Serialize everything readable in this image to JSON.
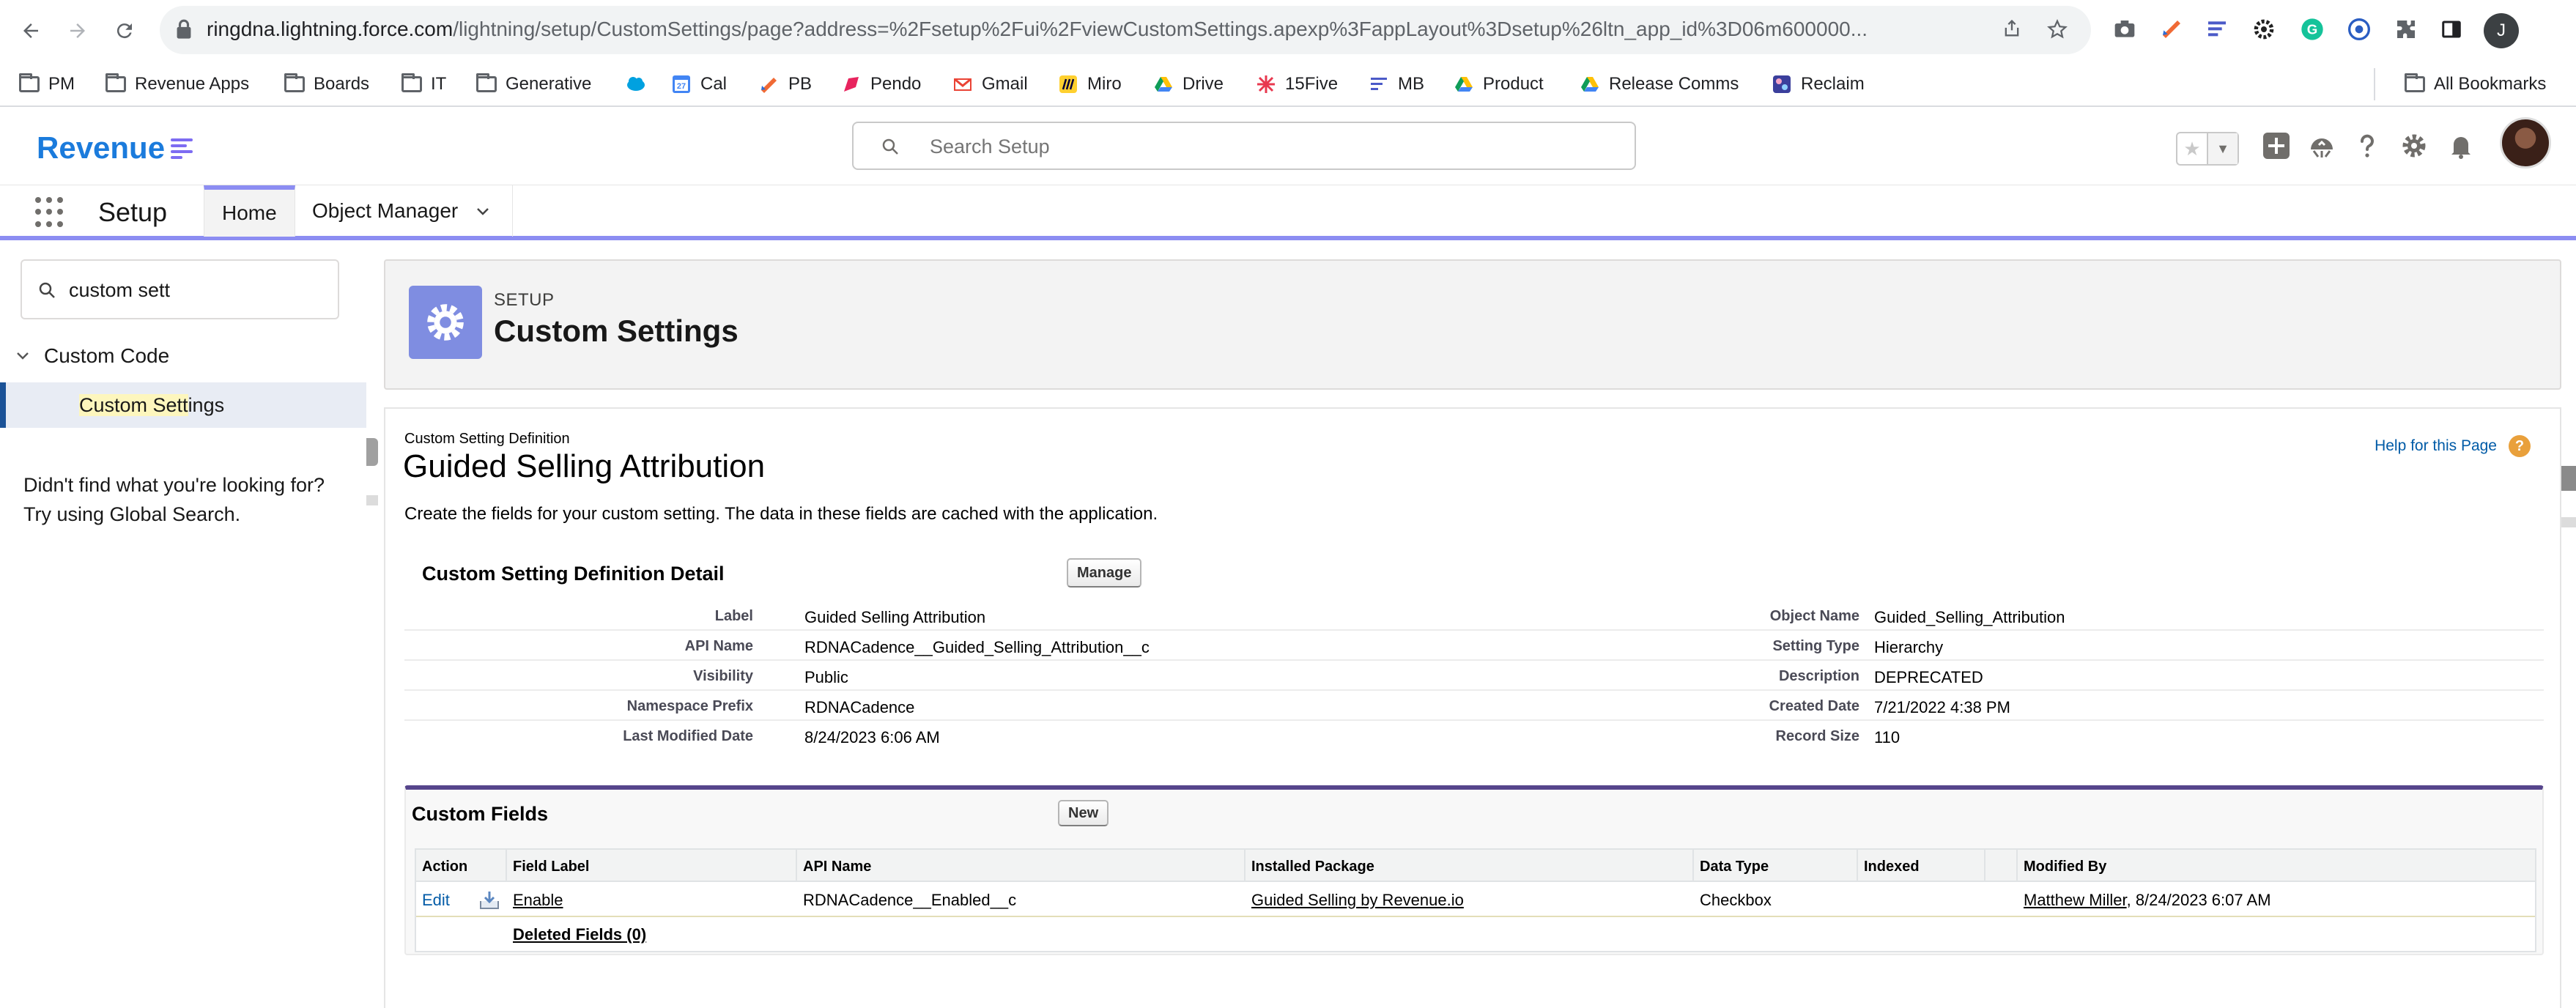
{
  "browser": {
    "url_host": "ringdna.lightning.force.com",
    "url_path": "/lightning/setup/CustomSettings/page?address=%2Fsetup%2Fui%2FviewCustomSettings.apexp%3FappLayout%3Dsetup%26ltn_app_id%3D06m600000...",
    "profile_initial": "J",
    "bookmarks": [
      {
        "label": "PM",
        "icon": "folder-icon"
      },
      {
        "label": "Revenue Apps",
        "icon": "folder-icon"
      },
      {
        "label": "Boards",
        "icon": "folder-icon"
      },
      {
        "label": "IT",
        "icon": "folder-icon"
      },
      {
        "label": "Generative",
        "icon": "folder-icon"
      },
      {
        "label": "",
        "icon": "salesforce-icon"
      },
      {
        "label": "Cal",
        "icon": "calendar-icon"
      },
      {
        "label": "PB",
        "icon": "pb-icon"
      },
      {
        "label": "Pendo",
        "icon": "pendo-icon"
      },
      {
        "label": "Gmail",
        "icon": "gmail-icon"
      },
      {
        "label": "Miro",
        "icon": "miro-icon"
      },
      {
        "label": "Drive",
        "icon": "drive-icon"
      },
      {
        "label": "15Five",
        "icon": "15five-icon"
      },
      {
        "label": "MB",
        "icon": "mb-icon"
      },
      {
        "label": "Product",
        "icon": "drive-icon"
      },
      {
        "label": "Release Comms",
        "icon": "drive-icon"
      },
      {
        "label": "Reclaim",
        "icon": "reclaim-icon"
      }
    ],
    "all_bookmarks": "All Bookmarks"
  },
  "header": {
    "logo_text": "Revenue",
    "search_placeholder": "Search Setup"
  },
  "nav": {
    "title": "Setup",
    "tabs": [
      {
        "label": "Home",
        "active": true
      },
      {
        "label": "Object Manager",
        "active": false
      }
    ]
  },
  "sidebar": {
    "quickfind_value": "custom sett",
    "group_label": "Custom Code",
    "item_highlight": "Custom Sett",
    "item_rest": "ings",
    "not_found_line1": "Didn't find what you're looking for?",
    "not_found_line2": "Try using Global Search."
  },
  "page": {
    "eyebrow": "SETUP",
    "title": "Custom Settings"
  },
  "definition": {
    "eyebrow": "Custom Setting Definition",
    "title": "Guided Selling Attribution",
    "help_link": "Help for this Page",
    "intro": "Create the fields for your custom setting. The data in these fields are cached with the application.",
    "section_title": "Custom Setting Definition Detail",
    "manage_button": "Manage",
    "rows": [
      {
        "label_left": "Label",
        "value_left": "Guided Selling Attribution",
        "label_right": "Object Name",
        "value_right": "Guided_Selling_Attribution"
      },
      {
        "label_left": "API Name",
        "value_left": "RDNACadence__Guided_Selling_Attribution__c",
        "label_right": "Setting Type",
        "value_right": "Hierarchy"
      },
      {
        "label_left": "Visibility",
        "value_left": "Public",
        "label_right": "Description",
        "value_right": "DEPRECATED"
      },
      {
        "label_left": "Namespace Prefix",
        "value_left": "RDNACadence",
        "label_right": "Created Date",
        "value_right": "7/21/2022 4:38 PM"
      },
      {
        "label_left": "Last Modified Date",
        "value_left": "8/24/2023 6:06 AM",
        "label_right": "Record Size",
        "value_right": "110"
      }
    ]
  },
  "custom_fields": {
    "title": "Custom Fields",
    "new_button": "New",
    "columns": [
      "Action",
      "Field Label",
      "API Name",
      "Installed Package",
      "Data Type",
      "Indexed",
      "Modified By"
    ],
    "row": {
      "action": "Edit",
      "field_label": "Enable",
      "api_name": "RDNACadence__Enabled__c",
      "installed_package": "Guided Selling by Revenue.io",
      "data_type": "Checkbox",
      "indexed": "",
      "modified_by_name": "Matthew Miller",
      "modified_by_date": ", 8/24/2023 6:07 AM"
    },
    "deleted_link": "Deleted Fields (0)"
  },
  "colors": {
    "brand_blue": "#1b7bdc",
    "nav_accent": "#8c8df2",
    "setup_icon": "#7f8de1",
    "related_list_border": "#56458c",
    "link_blue": "#015ba7",
    "help_icon": "#e9a03b"
  }
}
